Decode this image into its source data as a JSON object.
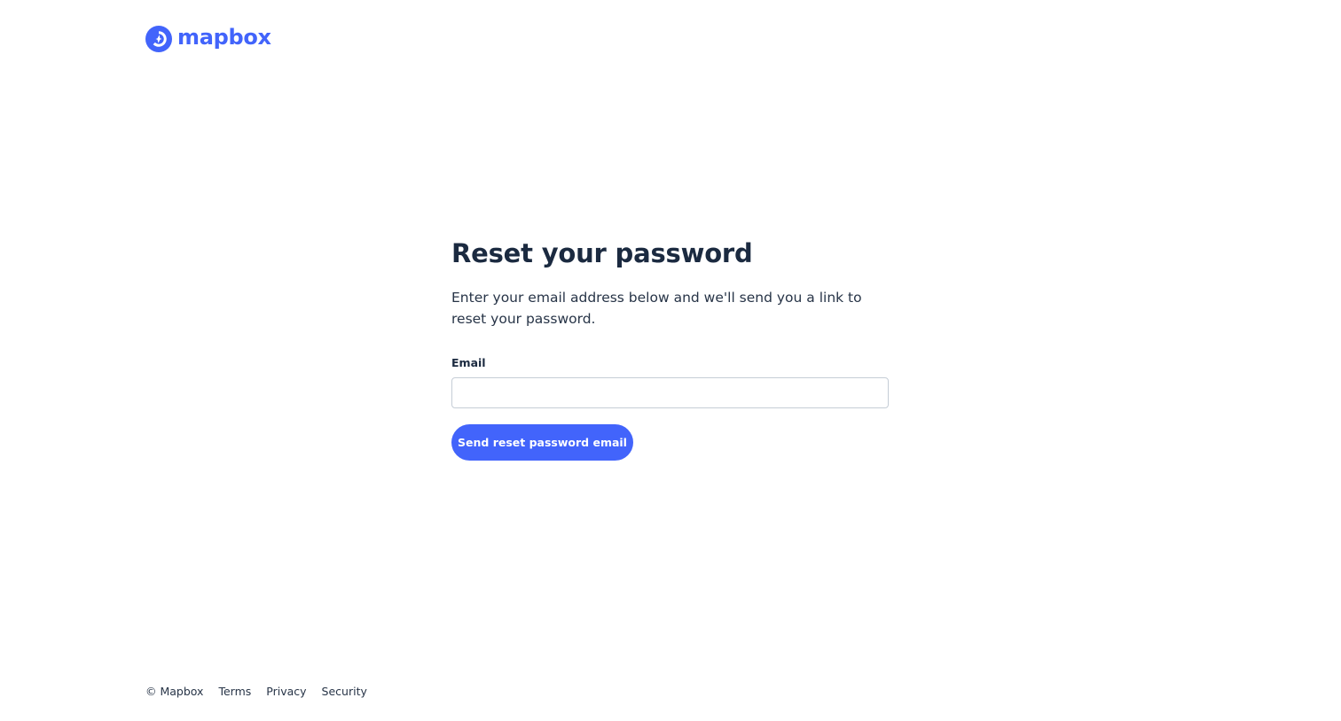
{
  "brand": {
    "name": "mapbox",
    "color": "#4264fb",
    "logo_icon": "mapbox-compass-logo"
  },
  "main": {
    "title": "Reset your password",
    "subtitle": "Enter your email address below and we'll send you a link to reset your password.",
    "email_label": "Email",
    "email_value": "",
    "email_placeholder": "",
    "submit_label": "Send reset password email"
  },
  "footer": {
    "copyright": "© Mapbox",
    "links": [
      {
        "label": "Terms"
      },
      {
        "label": "Privacy"
      },
      {
        "label": "Security"
      }
    ]
  },
  "colors": {
    "text": "#1b2a40",
    "accent": "#4264fb",
    "input_border": "#c5cdd6"
  }
}
